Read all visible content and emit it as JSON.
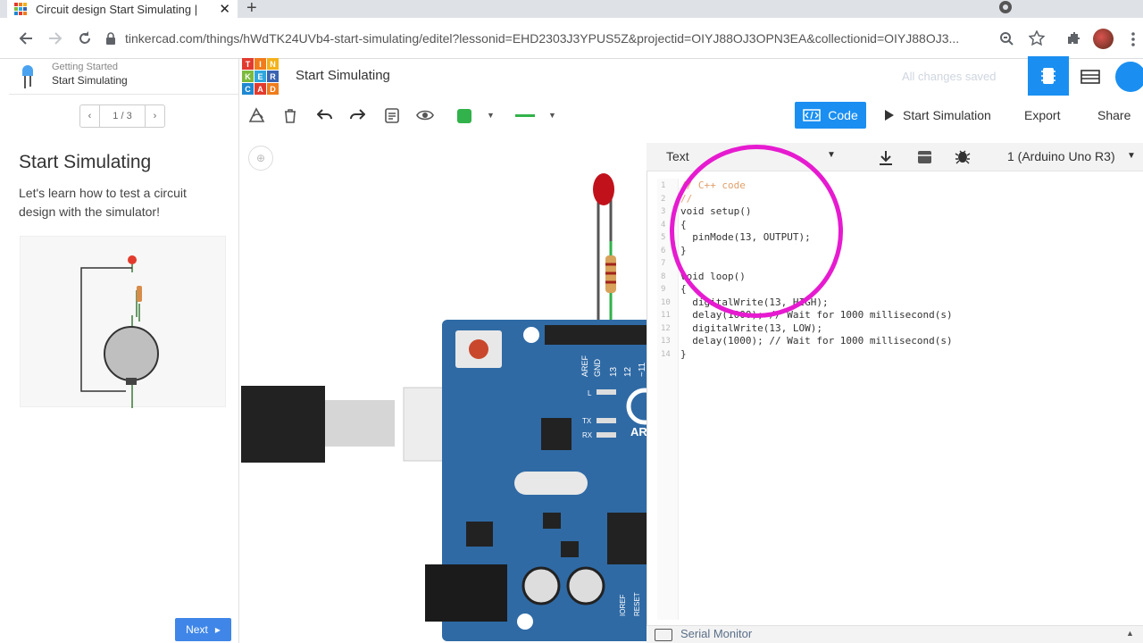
{
  "browser": {
    "tab_title": "Circuit design Start Simulating |",
    "url": "tinkercad.com/things/hWdTK24UVb4-start-simulating/editel?lessonid=EHD2303J3YPUS5Z&projectid=OIYJ88OJ3OPN3EA&collectionid=OIYJ88OJ3...",
    "new_tab": "+",
    "close_tab": "✕"
  },
  "lesson": {
    "section": "Getting Started",
    "name": "Start Simulating",
    "pager": {
      "prev": "‹",
      "current": "1 / 3",
      "next": "›"
    },
    "title": "Start Simulating",
    "description": "Let's learn how to test a circuit design with the simulator!",
    "next_button": "Next"
  },
  "header": {
    "logo_letters": [
      "T",
      "I",
      "N",
      "K",
      "E",
      "R",
      "C",
      "A",
      "D"
    ],
    "logo_colors": [
      "#e23b2e",
      "#f07c1c",
      "#f3b21b",
      "#7cba3d",
      "#2fa6dc",
      "#3a62b0",
      "#1e88d2",
      "#e23b2e",
      "#f07c1c"
    ],
    "project_title": "Start Simulating",
    "saved_status": "All changes saved"
  },
  "toolbar": {
    "code_label": "Code",
    "start_sim_label": "Start Simulation",
    "export_label": "Export",
    "share_label": "Share"
  },
  "code_panel": {
    "mode": "Text",
    "device": "1 (Arduino Uno R3)",
    "serial_monitor": "Serial Monitor",
    "lines": [
      {
        "n": "1",
        "t": "// C++ code",
        "c": true
      },
      {
        "n": "2",
        "t": "//",
        "c": true
      },
      {
        "n": "3",
        "t": "void setup()",
        "c": false
      },
      {
        "n": "4",
        "t": "{",
        "c": false
      },
      {
        "n": "5",
        "t": "  pinMode(13, OUTPUT);",
        "c": false
      },
      {
        "n": "6",
        "t": "}",
        "c": false
      },
      {
        "n": "7",
        "t": "",
        "c": false
      },
      {
        "n": "8",
        "t": "void loop()",
        "c": false
      },
      {
        "n": "9",
        "t": "{",
        "c": false
      },
      {
        "n": "10",
        "t": "  digitalWrite(13, HIGH);",
        "c": false
      },
      {
        "n": "11",
        "t": "  delay(1000); // Wait for 1000 millisecond(s)",
        "c": false
      },
      {
        "n": "12",
        "t": "  digitalWrite(13, LOW);",
        "c": false
      },
      {
        "n": "13",
        "t": "  delay(1000); // Wait for 1000 millisecond(s)",
        "c": false
      },
      {
        "n": "14",
        "t": "}",
        "c": false
      }
    ]
  },
  "board": {
    "labels": [
      "AREF",
      "GND",
      "13",
      "12",
      "~11"
    ],
    "side_labels": [
      "L",
      "TX",
      "RX"
    ],
    "bottom_labels": [
      "IOREF",
      "RESET"
    ],
    "brand": "AR"
  },
  "colors": {
    "accent": "#1a8ff1",
    "highlight": "#e61bd0",
    "board": "#2f6aa5",
    "led": "#c1121c"
  }
}
